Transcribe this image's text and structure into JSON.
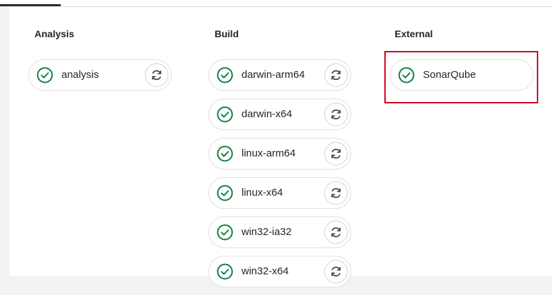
{
  "columns": {
    "analysis": {
      "title": "Analysis",
      "jobs": [
        {
          "label": "analysis",
          "status": "success"
        }
      ]
    },
    "build": {
      "title": "Build",
      "jobs": [
        {
          "label": "darwin-arm64",
          "status": "success"
        },
        {
          "label": "darwin-x64",
          "status": "success"
        },
        {
          "label": "linux-arm64",
          "status": "success"
        },
        {
          "label": "linux-x64",
          "status": "success"
        },
        {
          "label": "win32-ia32",
          "status": "success"
        },
        {
          "label": "win32-x64",
          "status": "success"
        }
      ]
    },
    "external": {
      "title": "External",
      "jobs": [
        {
          "label": "SonarQube",
          "status": "success"
        }
      ]
    }
  },
  "icons": {
    "status": "check-circle-icon",
    "retry": "refresh-icon"
  },
  "colors": {
    "success": "#107c41",
    "highlight": "#d0021b",
    "text": "#242424"
  }
}
